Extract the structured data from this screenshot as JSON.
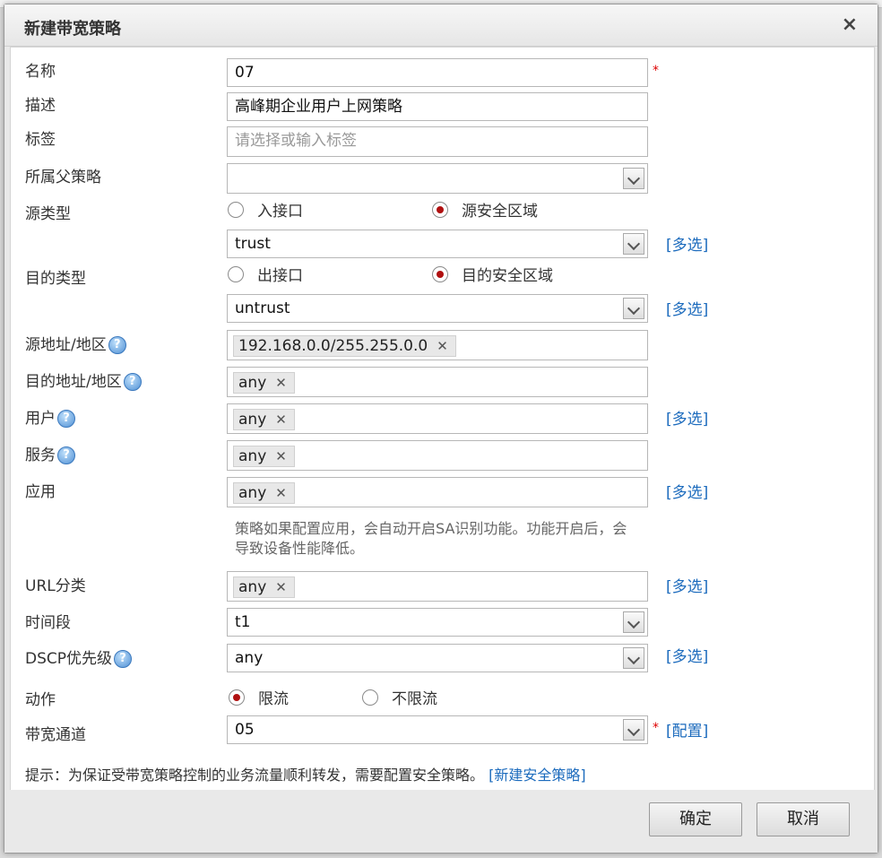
{
  "dialog": {
    "title": "新建带宽策略",
    "close": "×"
  },
  "form": {
    "name": {
      "label": "名称",
      "value": "07",
      "required": "*"
    },
    "desc": {
      "label": "描述",
      "value": "高峰期企业用户上网策略"
    },
    "tag": {
      "label": "标签",
      "placeholder": "请选择或输入标签"
    },
    "parent": {
      "label": "所属父策略",
      "value": ""
    },
    "src_type": {
      "label": "源类型",
      "option1": "入接口",
      "option2": "源安全区域",
      "selected": "源安全区域"
    },
    "src_zone": {
      "value": "trust",
      "multi": "[多选]"
    },
    "dst_type": {
      "label": "目的类型",
      "option1": "出接口",
      "option2": "目的安全区域",
      "selected": "目的安全区域"
    },
    "dst_zone": {
      "value": "untrust",
      "multi": "[多选]"
    },
    "src_addr": {
      "label": "源地址/地区",
      "tag": "192.168.0.0/255.255.0.0"
    },
    "dst_addr": {
      "label": "目的地址/地区",
      "tag": "any"
    },
    "user": {
      "label": "用户",
      "tag": "any",
      "multi": "[多选]"
    },
    "service": {
      "label": "服务",
      "tag": "any"
    },
    "app": {
      "label": "应用",
      "tag": "any",
      "multi": "[多选]",
      "note": "策略如果配置应用，会自动开启SA识别功能。功能开启后，会导致设备性能降低。"
    },
    "url": {
      "label": "URL分类",
      "tag": "any",
      "multi": "[多选]"
    },
    "time": {
      "label": "时间段",
      "value": "t1"
    },
    "dscp": {
      "label": "DSCP优先级",
      "value": "any",
      "multi": "[多选]"
    },
    "action": {
      "label": "动作",
      "option1": "限流",
      "option2": "不限流",
      "selected": "限流"
    },
    "channel": {
      "label": "带宽通道",
      "value": "05",
      "required": "*",
      "config": "[配置]"
    },
    "hint": {
      "text": "提示：为保证受带宽策略控制的业务流量顺利转发，需要配置安全策略。",
      "link": "[新建安全策略]"
    }
  },
  "buttons": {
    "ok": "确定",
    "cancel": "取消"
  },
  "help_icon": "?",
  "remove_icon": "✕"
}
